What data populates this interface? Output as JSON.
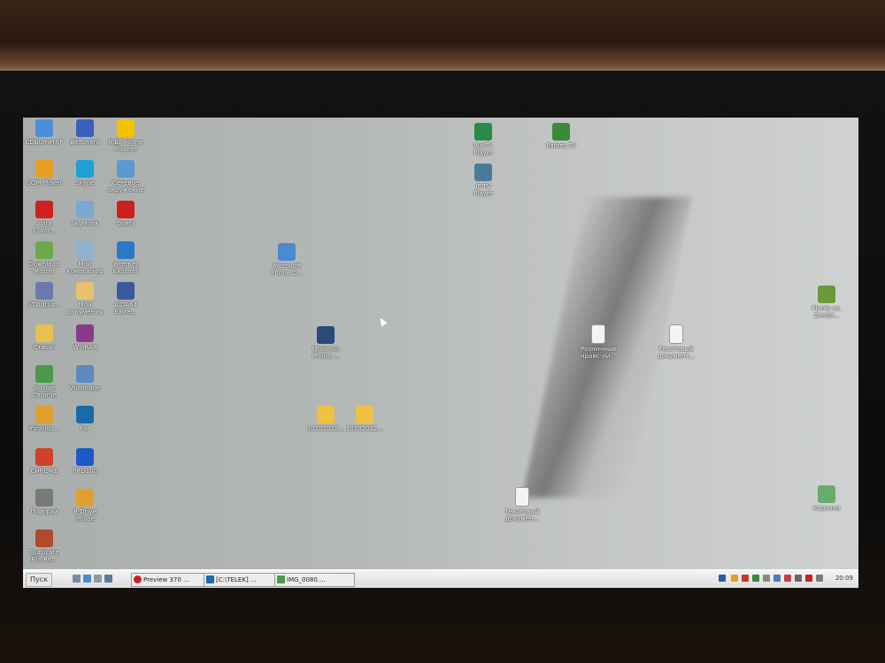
{
  "desktop": {
    "icons": [
      {
        "label": "CDBurnerXP",
        "icon": "cd-icon",
        "color": "#4a8fd8"
      },
      {
        "label": "BitTorrent",
        "icon": "bittorrent-icon",
        "color": "#3b5fbf"
      },
      {
        "label": "IKEA Home\nPlanner",
        "icon": "ikea-icon",
        "color": "#f2c200"
      },
      {
        "label": "GOM Player",
        "icon": "gom-player-icon",
        "color": "#e8a020"
      },
      {
        "label": "Skype",
        "icon": "skype-icon",
        "color": "#1fa0d8"
      },
      {
        "label": "Сетевое\nокружение",
        "icon": "network-icon",
        "color": "#5a9ad0"
      },
      {
        "label": "Avira\nContr...",
        "icon": "avira-icon",
        "color": "#d02020"
      },
      {
        "label": "SkyMonk",
        "icon": "skymonk-icon",
        "color": "#7aa8d0"
      },
      {
        "label": "Opera",
        "icon": "opera-icon",
        "color": "#cc1f1f"
      },
      {
        "label": "Download\nMaster",
        "icon": "download-master-icon",
        "color": "#6aaa4a"
      },
      {
        "label": "Мой\nкомпьютер",
        "icon": "my-computer-icon",
        "color": "#8fb2d0"
      },
      {
        "label": "Internet\nExplorer",
        "icon": "internet-explorer-icon",
        "color": "#2a78c8"
      },
      {
        "label": "STDUtilit...",
        "icon": "stdu-icon",
        "color": "#6a7ab0"
      },
      {
        "label": "Мои\nдокументы",
        "icon": "my-documents-icon",
        "color": "#e8c070"
      },
      {
        "label": "AIDA64\nExtre...",
        "icon": "aida64-icon",
        "color": "#3a5aa0"
      },
      {
        "label": "Стасяг",
        "icon": "folder-icon",
        "color": "#e8c050"
      },
      {
        "label": "WinRAR",
        "icon": "winrar-icon",
        "color": "#8a3a8a"
      },
      {
        "label": "Google\nChrome",
        "icon": "chrome-icon",
        "color": "#4a9a4a"
      },
      {
        "label": "WinImage",
        "icon": "winimage-icon",
        "color": "#5a8ac0"
      },
      {
        "label": "miranda...",
        "icon": "miranda-icon",
        "color": "#e0a030"
      },
      {
        "label": "Far",
        "icon": "far-icon",
        "color": "#1a6aaa"
      },
      {
        "label": "CHROME",
        "icon": "chrome-icon",
        "color": "#d0402a"
      },
      {
        "label": "PRO100",
        "icon": "pro100-icon",
        "color": "#1a5ac8"
      },
      {
        "label": "Поиграй",
        "icon": "games-icon",
        "color": "#7a7a7a"
      },
      {
        "label": "R-Drive\nImage",
        "icon": "r-drive-icon",
        "color": "#e0a030"
      },
      {
        "label": "Duplicate\nFile Re...",
        "icon": "duplicate-file-icon",
        "color": "#b04a2a"
      },
      {
        "label": "Microsoft\nPhone D...",
        "icon": "phone-driver-icon",
        "color": "#4a8ad0"
      },
      {
        "label": "Motorola\nPhone ...",
        "icon": "motorola-icon",
        "color": "#2a4a7a"
      },
      {
        "label": "10102012...",
        "icon": "image-file-icon",
        "color": "#f0c040"
      },
      {
        "label": "10102012...",
        "icon": "image-file-icon",
        "color": "#f0c040"
      },
      {
        "label": "RusTV\nPlayer",
        "icon": "tv-player-icon",
        "color": "#2a8a4a"
      },
      {
        "label": "IP-TV\nPlayer",
        "icon": "iptv-icon",
        "color": "#4a7a9a"
      },
      {
        "label": "Parom.TV",
        "icon": "parom-tv-icon",
        "color": "#3a8a3a"
      },
      {
        "label": "Розничный\nпрайс-ли...",
        "icon": "text-file-icon",
        "color": "#f4f4f4"
      },
      {
        "label": "Текстовый\nдокумент...",
        "icon": "text-file-icon",
        "color": "#f4f4f4"
      },
      {
        "label": "Текстовый\nдокумен...",
        "icon": "text-file-icon",
        "color": "#f4f4f4"
      },
      {
        "label": "Plants vs.\nZombi...",
        "icon": "plants-zombies-icon",
        "color": "#6a9a3a"
      },
      {
        "label": "Корзина",
        "icon": "recycle-bin-icon",
        "color": "#6aaa6a"
      }
    ]
  },
  "taskbar": {
    "start_label": "Пуск",
    "tasks": [
      {
        "label": "Preview 370 ...",
        "color": "#cc1f1f"
      },
      {
        "label": "[C:\\TELEK] ...",
        "color": "#1a6aaa"
      },
      {
        "label": "IMG_0080....",
        "color": "#4a9a4a"
      }
    ],
    "clock": "20:09"
  }
}
